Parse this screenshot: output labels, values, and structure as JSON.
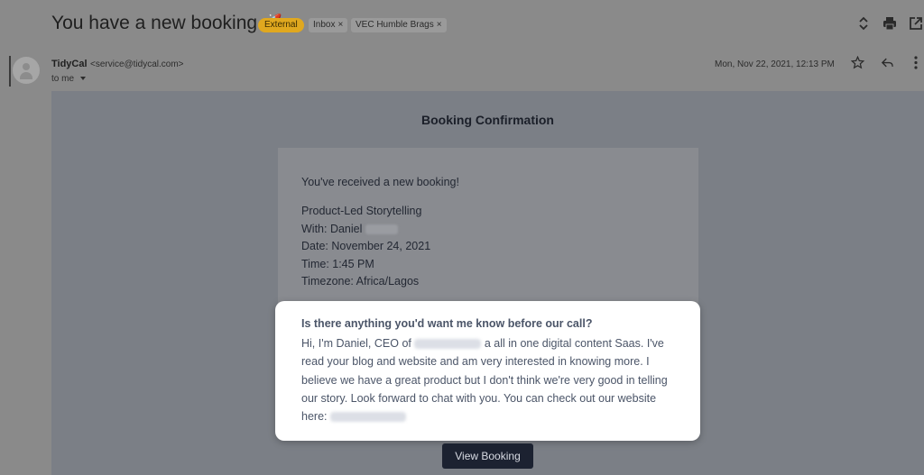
{
  "subject": {
    "title": "You have a new booking",
    "emoji": "🚀"
  },
  "labels": [
    {
      "text": "External",
      "removable": false
    },
    {
      "text": "Inbox",
      "removable": true
    },
    {
      "text": "VEC Humble Brags",
      "removable": true
    }
  ],
  "label_remove_glyph": "×",
  "header_icons": {
    "expand": "⌃⌄",
    "print": "🖶",
    "open_new": "↗"
  },
  "sender": {
    "name": "TidyCal",
    "email": "<service@tidycal.com>",
    "recipient": "to me",
    "date": "Mon, Nov 22, 2021, 12:13 PM"
  },
  "actions": {
    "star": "☆",
    "reply": "↩",
    "more": "⋮"
  },
  "email": {
    "title": "Booking Confirmation",
    "intro": "You've received a new booking!",
    "details": {
      "event": "Product-Led Storytelling",
      "with": "With: Daniel",
      "date": "Date: November 24, 2021",
      "time": "Time: 1:45 PM",
      "timezone": "Timezone: Africa/Lagos"
    },
    "question": "Is there anything you'd want me know before our call?",
    "answer": {
      "part1": "Hi, I'm Daniel, CEO of",
      "part2": "a all in one digital content Saas. I've read your blog and website and am very interested in knowing more. I believe we have a great product but I don't think we're very good in telling our story. Look forward to chat with you. You can check out our website here:"
    },
    "button": "View Booking"
  },
  "colors": {
    "label_external": "#e0a81f",
    "button_bg": "#1c2231",
    "highlight_text": "#4b5568"
  }
}
